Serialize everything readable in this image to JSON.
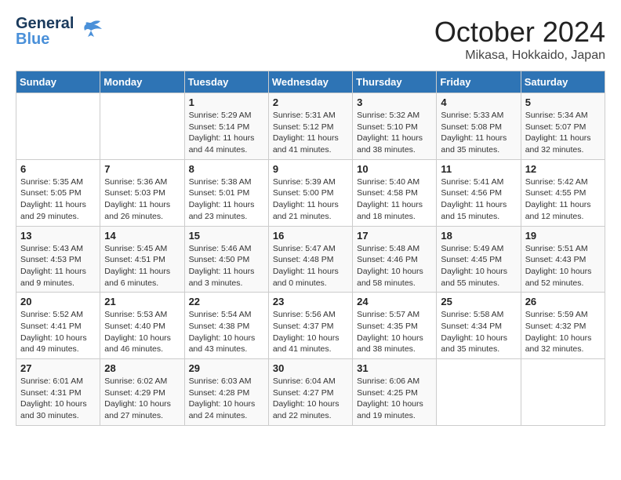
{
  "header": {
    "logo_line1": "General",
    "logo_line2": "Blue",
    "month": "October 2024",
    "location": "Mikasa, Hokkaido, Japan"
  },
  "days_of_week": [
    "Sunday",
    "Monday",
    "Tuesday",
    "Wednesday",
    "Thursday",
    "Friday",
    "Saturday"
  ],
  "weeks": [
    [
      {
        "day": "",
        "info": ""
      },
      {
        "day": "",
        "info": ""
      },
      {
        "day": "1",
        "info": "Sunrise: 5:29 AM\nSunset: 5:14 PM\nDaylight: 11 hours and 44 minutes."
      },
      {
        "day": "2",
        "info": "Sunrise: 5:31 AM\nSunset: 5:12 PM\nDaylight: 11 hours and 41 minutes."
      },
      {
        "day": "3",
        "info": "Sunrise: 5:32 AM\nSunset: 5:10 PM\nDaylight: 11 hours and 38 minutes."
      },
      {
        "day": "4",
        "info": "Sunrise: 5:33 AM\nSunset: 5:08 PM\nDaylight: 11 hours and 35 minutes."
      },
      {
        "day": "5",
        "info": "Sunrise: 5:34 AM\nSunset: 5:07 PM\nDaylight: 11 hours and 32 minutes."
      }
    ],
    [
      {
        "day": "6",
        "info": "Sunrise: 5:35 AM\nSunset: 5:05 PM\nDaylight: 11 hours and 29 minutes."
      },
      {
        "day": "7",
        "info": "Sunrise: 5:36 AM\nSunset: 5:03 PM\nDaylight: 11 hours and 26 minutes."
      },
      {
        "day": "8",
        "info": "Sunrise: 5:38 AM\nSunset: 5:01 PM\nDaylight: 11 hours and 23 minutes."
      },
      {
        "day": "9",
        "info": "Sunrise: 5:39 AM\nSunset: 5:00 PM\nDaylight: 11 hours and 21 minutes."
      },
      {
        "day": "10",
        "info": "Sunrise: 5:40 AM\nSunset: 4:58 PM\nDaylight: 11 hours and 18 minutes."
      },
      {
        "day": "11",
        "info": "Sunrise: 5:41 AM\nSunset: 4:56 PM\nDaylight: 11 hours and 15 minutes."
      },
      {
        "day": "12",
        "info": "Sunrise: 5:42 AM\nSunset: 4:55 PM\nDaylight: 11 hours and 12 minutes."
      }
    ],
    [
      {
        "day": "13",
        "info": "Sunrise: 5:43 AM\nSunset: 4:53 PM\nDaylight: 11 hours and 9 minutes."
      },
      {
        "day": "14",
        "info": "Sunrise: 5:45 AM\nSunset: 4:51 PM\nDaylight: 11 hours and 6 minutes."
      },
      {
        "day": "15",
        "info": "Sunrise: 5:46 AM\nSunset: 4:50 PM\nDaylight: 11 hours and 3 minutes."
      },
      {
        "day": "16",
        "info": "Sunrise: 5:47 AM\nSunset: 4:48 PM\nDaylight: 11 hours and 0 minutes."
      },
      {
        "day": "17",
        "info": "Sunrise: 5:48 AM\nSunset: 4:46 PM\nDaylight: 10 hours and 58 minutes."
      },
      {
        "day": "18",
        "info": "Sunrise: 5:49 AM\nSunset: 4:45 PM\nDaylight: 10 hours and 55 minutes."
      },
      {
        "day": "19",
        "info": "Sunrise: 5:51 AM\nSunset: 4:43 PM\nDaylight: 10 hours and 52 minutes."
      }
    ],
    [
      {
        "day": "20",
        "info": "Sunrise: 5:52 AM\nSunset: 4:41 PM\nDaylight: 10 hours and 49 minutes."
      },
      {
        "day": "21",
        "info": "Sunrise: 5:53 AM\nSunset: 4:40 PM\nDaylight: 10 hours and 46 minutes."
      },
      {
        "day": "22",
        "info": "Sunrise: 5:54 AM\nSunset: 4:38 PM\nDaylight: 10 hours and 43 minutes."
      },
      {
        "day": "23",
        "info": "Sunrise: 5:56 AM\nSunset: 4:37 PM\nDaylight: 10 hours and 41 minutes."
      },
      {
        "day": "24",
        "info": "Sunrise: 5:57 AM\nSunset: 4:35 PM\nDaylight: 10 hours and 38 minutes."
      },
      {
        "day": "25",
        "info": "Sunrise: 5:58 AM\nSunset: 4:34 PM\nDaylight: 10 hours and 35 minutes."
      },
      {
        "day": "26",
        "info": "Sunrise: 5:59 AM\nSunset: 4:32 PM\nDaylight: 10 hours and 32 minutes."
      }
    ],
    [
      {
        "day": "27",
        "info": "Sunrise: 6:01 AM\nSunset: 4:31 PM\nDaylight: 10 hours and 30 minutes."
      },
      {
        "day": "28",
        "info": "Sunrise: 6:02 AM\nSunset: 4:29 PM\nDaylight: 10 hours and 27 minutes."
      },
      {
        "day": "29",
        "info": "Sunrise: 6:03 AM\nSunset: 4:28 PM\nDaylight: 10 hours and 24 minutes."
      },
      {
        "day": "30",
        "info": "Sunrise: 6:04 AM\nSunset: 4:27 PM\nDaylight: 10 hours and 22 minutes."
      },
      {
        "day": "31",
        "info": "Sunrise: 6:06 AM\nSunset: 4:25 PM\nDaylight: 10 hours and 19 minutes."
      },
      {
        "day": "",
        "info": ""
      },
      {
        "day": "",
        "info": ""
      }
    ]
  ]
}
